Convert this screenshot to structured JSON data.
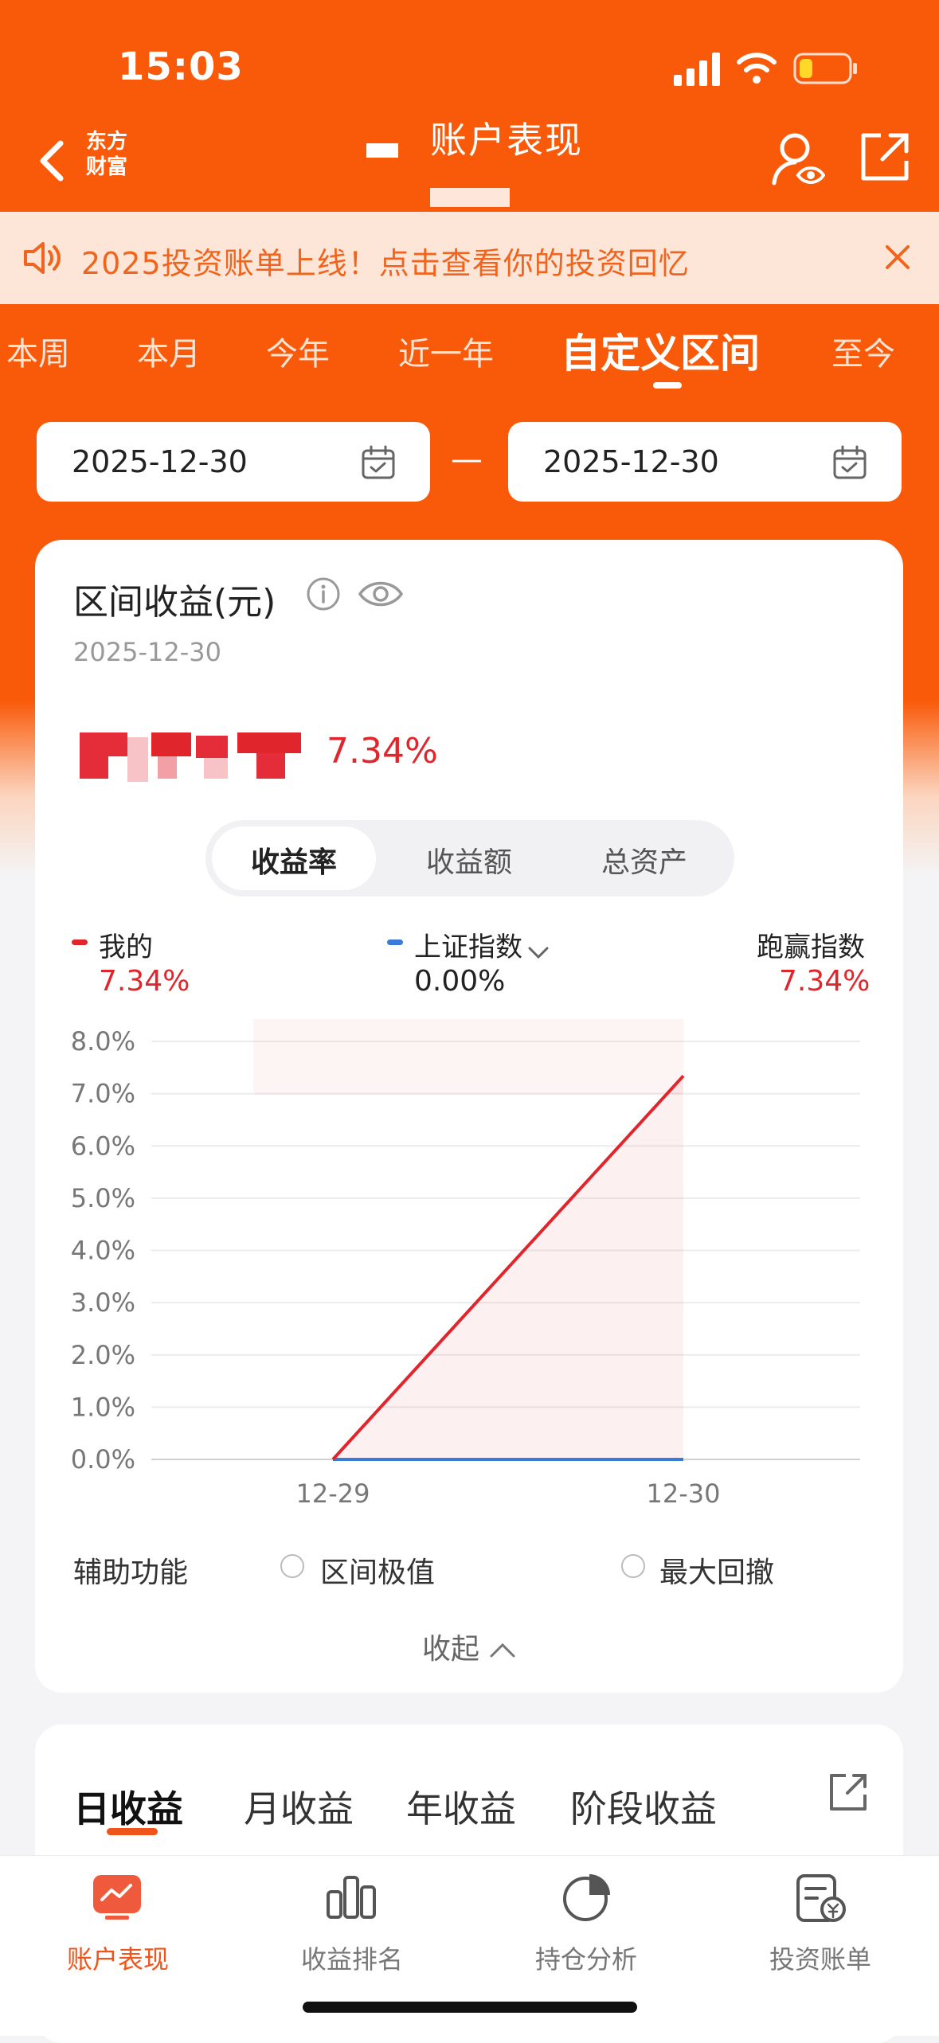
{
  "status_bar": {
    "time": "15:03"
  },
  "header": {
    "logo_line1": "东方",
    "logo_line2": "财富",
    "title": "账户表现"
  },
  "notice": {
    "text": "2025投资账单上线！点击查看你的投资回忆"
  },
  "period_tabs": [
    {
      "label": "本周",
      "active": false
    },
    {
      "label": "本月",
      "active": false
    },
    {
      "label": "今年",
      "active": false
    },
    {
      "label": "近一年",
      "active": false
    },
    {
      "label": "自定义区间",
      "active": true
    },
    {
      "label": "至今",
      "active": false
    }
  ],
  "date_range": {
    "start": "2025-12-30",
    "separator": "—",
    "end": "2025-12-30"
  },
  "summary": {
    "title": "区间收益(元)",
    "date": "2025-12-30",
    "return_pct": "7.34%"
  },
  "metric_toggle": [
    "收益率",
    "收益额",
    "总资产"
  ],
  "legend": {
    "mine": {
      "label": "我的",
      "value": "7.34%"
    },
    "index": {
      "label": "上证指数",
      "value": "0.00%"
    },
    "beat": {
      "label": "跑赢指数",
      "value": "7.34%"
    }
  },
  "chart_data": {
    "type": "line",
    "x": [
      "12-29",
      "12-30"
    ],
    "series": [
      {
        "name": "我的",
        "values": [
          0.0,
          7.34
        ],
        "color": "#e0262c"
      },
      {
        "name": "上证指数",
        "values": [
          0.0,
          0.0
        ],
        "color": "#3a7bd5"
      }
    ],
    "yticks": [
      "0.0%",
      "1.0%",
      "2.0%",
      "3.0%",
      "4.0%",
      "5.0%",
      "6.0%",
      "7.0%",
      "8.0%"
    ],
    "ylim": [
      0,
      8
    ],
    "grid": true
  },
  "aux": {
    "label": "辅助功能",
    "opt1": "区间极值",
    "opt2": "最大回撤",
    "collapse": "收起"
  },
  "bottom_tabs": [
    {
      "label": "日收益",
      "active": true
    },
    {
      "label": "月收益",
      "active": false
    },
    {
      "label": "年收益",
      "active": false
    },
    {
      "label": "阶段收益",
      "active": false
    }
  ],
  "bottom_nav": [
    {
      "label": "账户表现",
      "icon": "chart-trend-icon",
      "active": true
    },
    {
      "label": "收益排名",
      "icon": "bar-chart-icon",
      "active": false
    },
    {
      "label": "持仓分析",
      "icon": "pie-chart-icon",
      "active": false
    },
    {
      "label": "投资账单",
      "icon": "bill-icon",
      "active": false
    }
  ],
  "colors": {
    "brand": "#f95a0a",
    "up": "#e0262c",
    "index": "#3a7bd5"
  }
}
